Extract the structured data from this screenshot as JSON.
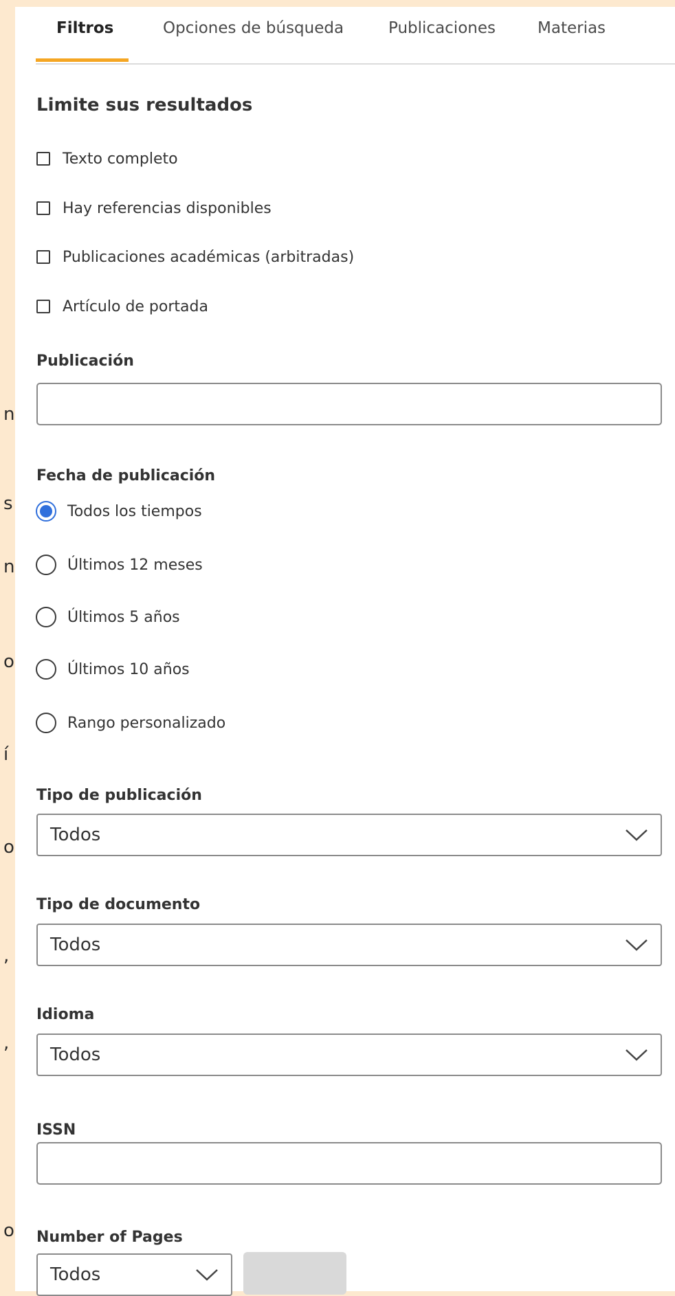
{
  "tabs": [
    "Filtros",
    "Opciones de búsqueda",
    "Publicaciones",
    "Materias"
  ],
  "limit_heading": "Limite sus resultados",
  "checkboxes": [
    "Texto completo",
    "Hay referencias disponibles",
    "Publicaciones académicas (arbitradas)",
    "Artículo de portada"
  ],
  "publication": {
    "label": "Publicación",
    "value": ""
  },
  "date": {
    "label": "Fecha de publicación",
    "options": [
      "Todos los tiempos",
      "Últimos 12 meses",
      "Últimos 5 años",
      "Últimos 10 años",
      "Rango personalizado"
    ],
    "selected": "Todos los tiempos"
  },
  "pub_type": {
    "label": "Tipo de publicación",
    "value": "Todos"
  },
  "doc_type": {
    "label": "Tipo de documento",
    "value": "Todos"
  },
  "language": {
    "label": "Idioma",
    "value": "Todos"
  },
  "issn": {
    "label": "ISSN",
    "value": ""
  },
  "pages": {
    "label": "Number of Pages",
    "value": "Todos"
  },
  "edge_glyphs": [
    "n",
    "s",
    "n",
    "o",
    "í",
    "o",
    ",",
    ",",
    "o"
  ],
  "colors": {
    "background": "#fde9cf",
    "accent": "#f5a623",
    "radio": "#2f6fdc",
    "border": "#8a8a8a"
  }
}
